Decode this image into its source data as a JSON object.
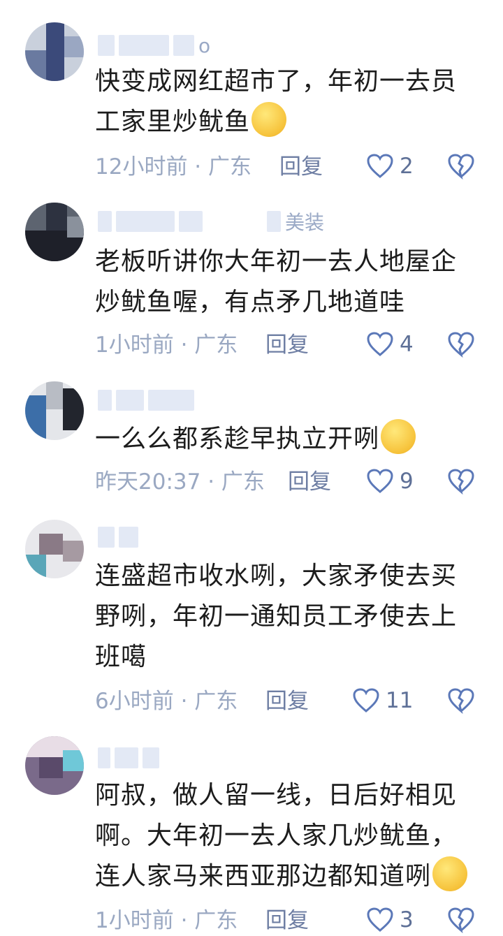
{
  "comments": [
    {
      "name_suffix": "o",
      "text": "快变成网红超市了，年初一去员工家里炒鱿鱼",
      "emoji": "crying-laughing-emoji",
      "time": "12小时前 · 广东",
      "reply_label": "回复",
      "likes": "2"
    },
    {
      "name_suffix": "美装",
      "text": "老板听讲你大年初一去人地屋企炒鱿鱼喔，有点矛几地道哇",
      "emoji": "",
      "time": "1小时前 · 广东",
      "reply_label": "回复",
      "likes": "4"
    },
    {
      "name_suffix": "",
      "text": "一么么都系趁早执立开咧",
      "emoji": "woozy-face-emoji",
      "time": "昨天20:37 · 广东",
      "reply_label": "回复",
      "likes": "9"
    },
    {
      "name_suffix": "",
      "text": "连盛超市收水咧，大家矛使去买野咧，年初一通知员工矛使去上班噶",
      "emoji": "",
      "time": "6小时前 · 广东",
      "reply_label": "回复",
      "likes": "11"
    },
    {
      "name_suffix": "",
      "text": "阿叔，做人留一线，日后好相见啊。大年初一去人家几炒鱿鱼，连人家马来西亚那边都知道咧",
      "emoji": "eye-roll-emoji",
      "time": "1小时前 · 广东",
      "reply_label": "回复",
      "likes": "3"
    }
  ],
  "colors": {
    "meta_text": "#9aa8c2",
    "icon_stroke": "#5b78b8"
  }
}
